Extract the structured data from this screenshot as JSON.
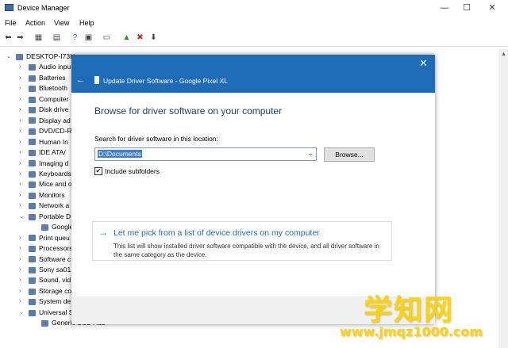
{
  "window": {
    "title": "Device Manager",
    "minimize": "—",
    "maximize": "☐",
    "close": "✕"
  },
  "menu": [
    "File",
    "Action",
    "View",
    "Help"
  ],
  "toolbar_icons": [
    "back-arrow-icon",
    "forward-arrow-icon",
    "properties-icon",
    "scan-icon",
    "help-icon",
    "details-icon",
    "monitor-icon",
    "add-driver-icon",
    "uninstall-icon",
    "update-icon"
  ],
  "tree": {
    "root": "DESKTOP-I73H...",
    "items": [
      "Audio inpu",
      "Batteries",
      "Bluetooth",
      "Computer",
      "Disk drive",
      "Display ad",
      "DVD/CD-R",
      "Human In",
      "IDE ATA/",
      "Imaging d",
      "Keyboards",
      "Mice and o",
      "Monitors",
      "Network a",
      "Portable D",
      "Google",
      "Print queu",
      "Processors",
      "Software c",
      "Sony sa01",
      "Sound, vid",
      "Storage co",
      "System de",
      "Universal S",
      "Generic USB Hub"
    ]
  },
  "dialog": {
    "title": "Update Driver Software - Google Pixel XL",
    "close": "✕",
    "back": "←",
    "header": "Browse for driver software on your computer",
    "search_label": "Search for driver software in this location:",
    "path_value": "D:\\Documents",
    "browse_label": "Browse...",
    "include_subfolders": "Include subfolders",
    "include_checked": "✔",
    "pick_title": "Let me pick from a list of device drivers on my computer",
    "pick_desc": "This list will show installed driver software compatible with the device, and all driver software in the same category as the device.",
    "pick_arrow": "→"
  },
  "watermark": {
    "cn": "学知网",
    "url": "www.jmqz1000.com"
  }
}
